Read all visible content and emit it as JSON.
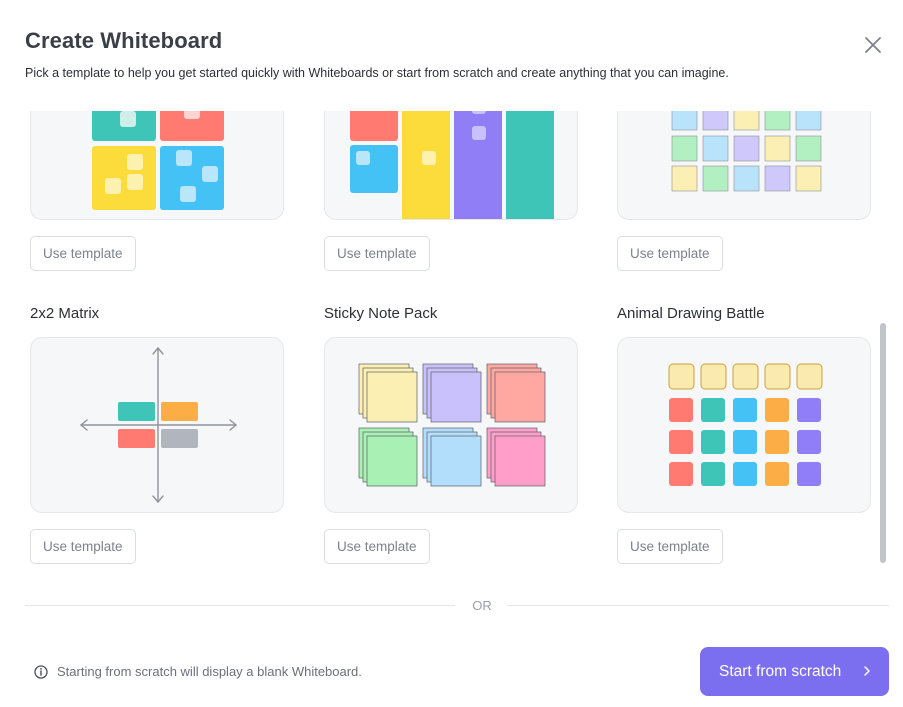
{
  "dialog": {
    "title": "Create Whiteboard",
    "subtitle": "Pick a template to help you get started quickly with Whiteboards or start from scratch and create anything that you can imagine.",
    "close_icon": "close-icon"
  },
  "templates": {
    "row1": [
      {
        "use_label": "Use template"
      },
      {
        "use_label": "Use template"
      },
      {
        "use_label": "Use template"
      }
    ],
    "row2": [
      {
        "name": "2x2 Matrix",
        "use_label": "Use template"
      },
      {
        "name": "Sticky Note Pack",
        "use_label": "Use template"
      },
      {
        "name": "Animal Drawing Battle",
        "use_label": "Use template"
      }
    ]
  },
  "divider": {
    "or_label": "OR"
  },
  "footer": {
    "info_icon": "info-icon",
    "note": "Starting from scratch will display a blank Whiteboard.",
    "start_label": "Start from scratch",
    "start_icon": "chevron-right-icon"
  },
  "colors": {
    "accent": "#7b6ff0",
    "teal": "#3fc4b8",
    "coral": "#ff7a70",
    "yellow": "#fcdc3a",
    "sky": "#45c2f5",
    "purple": "#8f7ef6",
    "orange": "#fcae46",
    "gray": "#b1b5bd"
  }
}
